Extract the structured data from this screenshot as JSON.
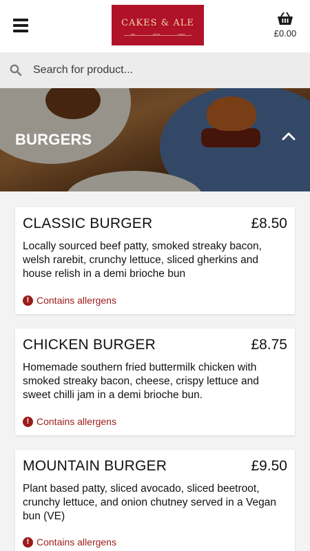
{
  "header": {
    "logo_text": "CAKES & ALE",
    "logo_sub": [
      "eat",
      "drink",
      "meet"
    ],
    "cart_total": "£0.00"
  },
  "search": {
    "placeholder": "Search for product..."
  },
  "category": {
    "title": "BURGERS"
  },
  "products": [
    {
      "name": "CLASSIC BURGER",
      "price": "£8.50",
      "description": "Locally sourced beef patty, smoked streaky bacon, welsh rarebit, crunchy lettuce, sliced gherkins and house relish in a demi brioche bun",
      "allergen_label": "Contains allergens"
    },
    {
      "name": "CHICKEN BURGER",
      "price": "£8.75",
      "description": "Homemade southern fried buttermilk chicken with smoked streaky bacon, cheese, crispy lettuce and sweet chilli jam in a demi brioche bun.",
      "allergen_label": "Contains allergens"
    },
    {
      "name": "MOUNTAIN BURGER",
      "price": "£9.50",
      "description": "Plant based patty, sliced avocado, sliced beetroot, crunchy lettuce, and onion chutney served in a Vegan bun (VE)",
      "allergen_label": "Contains allergens"
    }
  ],
  "colors": {
    "brand": "#b0122a",
    "allergen": "#9b1b1b",
    "background": "#f3f3f3"
  },
  "icons": {
    "menu": "hamburger-menu-icon",
    "cart": "basket-icon",
    "search": "search-icon",
    "collapse": "chevron-up-icon",
    "allergen": "exclamation-circle-icon"
  }
}
